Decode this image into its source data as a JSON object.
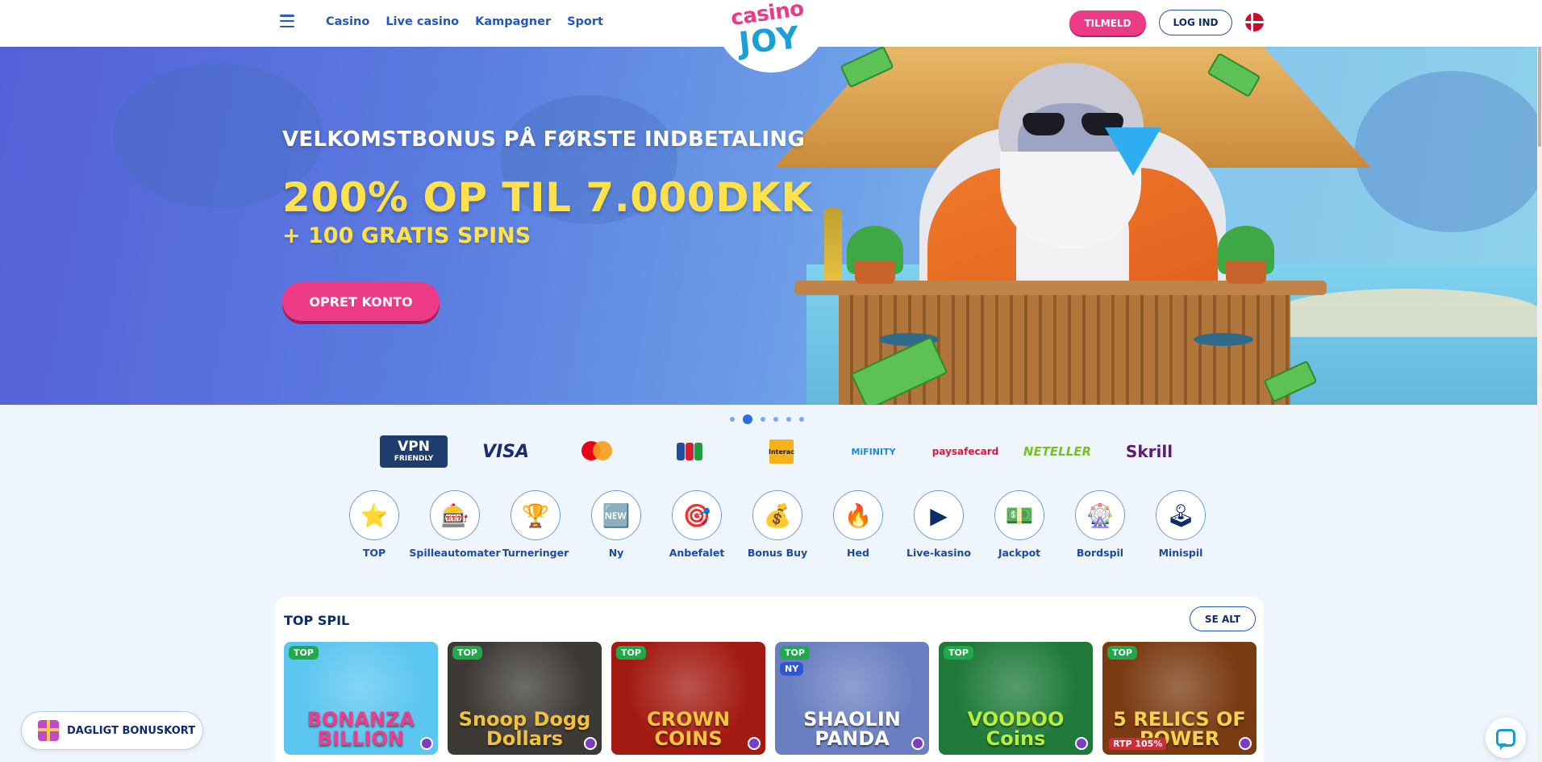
{
  "header": {
    "nav": [
      "Casino",
      "Live casino",
      "Kampagner",
      "Sport"
    ],
    "logo_top": "casino",
    "logo_bottom": "JOY",
    "signup_label": "TILMELD",
    "login_label": "LOG IND"
  },
  "hero": {
    "subtitle": "VELKOMSTBONUS PÅ FØRSTE INDBETALING",
    "headline": "200% OP TIL 7.000DKK",
    "spins": "+ 100 GRATIS SPINS",
    "cta": "OPRET KONTO",
    "slides_total": 6,
    "active_slide": 2
  },
  "payments": {
    "vpn_line1": "VPN",
    "vpn_line2": "FRIENDLY",
    "visa": "VISA",
    "interac": "Interac",
    "mifinity": "MiFINITY",
    "paysafe": "paysafecard",
    "neteller": "NETELLER",
    "skrill": "Skrill"
  },
  "categories": [
    {
      "label": "TOP",
      "icon": "star-icon",
      "glyph": "⭐"
    },
    {
      "label": "Spilleautomater",
      "icon": "slot-icon",
      "glyph": "🎰"
    },
    {
      "label": "Turneringer",
      "icon": "trophy-icon",
      "glyph": "🏆"
    },
    {
      "label": "Ny",
      "icon": "new-calendar-icon",
      "glyph": "🆕"
    },
    {
      "label": "Anbefalet",
      "icon": "win-icon",
      "glyph": "🎯"
    },
    {
      "label": "Bonus Buy",
      "icon": "chest-icon",
      "glyph": "💰"
    },
    {
      "label": "Hed",
      "icon": "fire-icon",
      "glyph": "🔥"
    },
    {
      "label": "Live-kasino",
      "icon": "play-icon",
      "glyph": "▶"
    },
    {
      "label": "Jackpot",
      "icon": "money-icon",
      "glyph": "💵"
    },
    {
      "label": "Bordspil",
      "icon": "roulette-icon",
      "glyph": "🎡"
    },
    {
      "label": "Minispil",
      "icon": "joystick-icon",
      "glyph": "🕹"
    }
  ],
  "top_games": {
    "title": "TOP SPIL",
    "see_all": "SE ALT",
    "badge_top": "TOP",
    "badge_new": "NY",
    "games": [
      {
        "name": "BONANZA BILLION",
        "bg": "#5bc6f0",
        "color": "#f23b8a",
        "new": false,
        "rtp": ""
      },
      {
        "name": "Snoop Dogg Dollars",
        "bg": "#3d3a36",
        "color": "#f3c23a",
        "new": false,
        "rtp": ""
      },
      {
        "name": "CROWN COINS",
        "bg": "#a31a12",
        "color": "#f7c63a",
        "new": false,
        "rtp": ""
      },
      {
        "name": "SHAOLIN PANDA",
        "bg": "#6a7fc2",
        "color": "#ffffff",
        "new": true,
        "rtp": ""
      },
      {
        "name": "VOODOO Coins",
        "bg": "#1f7a3a",
        "color": "#b7f03a",
        "new": false,
        "rtp": ""
      },
      {
        "name": "5 RELICS OF POWER",
        "bg": "#7a3a12",
        "color": "#f7d24a",
        "new": false,
        "rtp": "RTP 105%"
      }
    ]
  },
  "bonus_card": "DAGLIGT BONUSKORT",
  "colors": {
    "accent_pink": "#ec3a86",
    "link_blue": "#2457b8",
    "headline_yellow": "#ffe24a"
  }
}
